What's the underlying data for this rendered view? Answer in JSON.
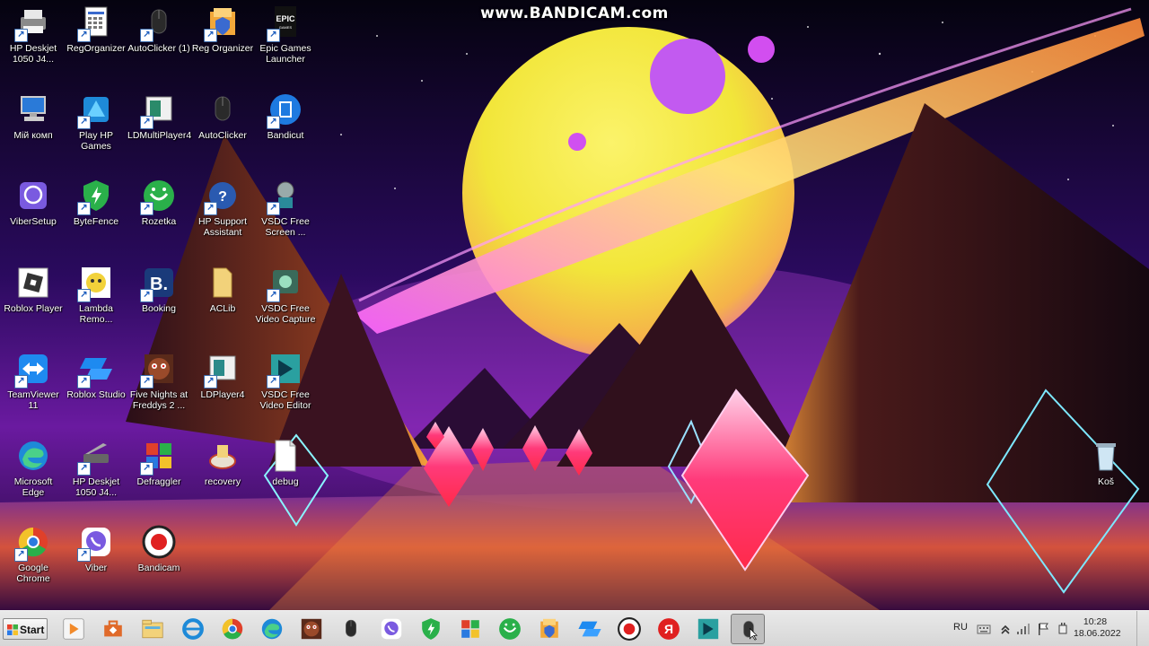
{
  "watermark": "www.BANDICAM.com",
  "desktop": {
    "icons": [
      {
        "label": "HP Deskjet 1050 J4...",
        "icon": "printer-icon"
      },
      {
        "label": "RegOrganizer",
        "icon": "registry-document-icon"
      },
      {
        "label": "AutoClicker (1)",
        "icon": "mouse-icon"
      },
      {
        "label": "Reg Organizer",
        "icon": "reg-organizer-icon"
      },
      {
        "label": "Epic Games Launcher",
        "icon": "epic-games-icon"
      },
      {
        "label": "Мій комп",
        "icon": "computer-icon"
      },
      {
        "label": "Play HP Games",
        "icon": "hp-games-icon"
      },
      {
        "label": "LDMultiPlayer4",
        "icon": "ldmultiplayer-icon"
      },
      {
        "label": "AutoClicker",
        "icon": "mouse-icon"
      },
      {
        "label": "Bandicut",
        "icon": "bandicut-icon"
      },
      {
        "label": "ViberSetup",
        "icon": "viber-setup-icon"
      },
      {
        "label": "ByteFence",
        "icon": "bytefence-shield-icon"
      },
      {
        "label": "Rozetka",
        "icon": "rozetka-icon"
      },
      {
        "label": "HP Support Assistant",
        "icon": "hp-support-icon"
      },
      {
        "label": "VSDC Free Screen ...",
        "icon": "vsdc-screen-icon"
      },
      {
        "label": "Roblox Player",
        "icon": "roblox-icon"
      },
      {
        "label": "Lambda Remo...",
        "icon": "lambda-remover-icon"
      },
      {
        "label": "Booking",
        "icon": "booking-icon"
      },
      {
        "label": "ACLib",
        "icon": "folder-icon"
      },
      {
        "label": "VSDC Free Video Capture",
        "icon": "vsdc-capture-icon"
      },
      {
        "label": "TeamViewer 11",
        "icon": "teamviewer-icon"
      },
      {
        "label": "Roblox Studio",
        "icon": "roblox-studio-icon"
      },
      {
        "label": "Five Nights at Freddys 2 ...",
        "icon": "fnaf-icon"
      },
      {
        "label": "LDPlayer4",
        "icon": "ldplayer-icon"
      },
      {
        "label": "VSDC Free Video Editor",
        "icon": "vsdc-editor-icon"
      },
      {
        "label": "Microsoft Edge",
        "icon": "edge-icon"
      },
      {
        "label": "HP Deskjet 1050 J4...",
        "icon": "scanner-icon"
      },
      {
        "label": "Defraggler",
        "icon": "defraggler-icon"
      },
      {
        "label": "recovery",
        "icon": "recovery-icon"
      },
      {
        "label": "debug",
        "icon": "text-file-icon"
      },
      {
        "label": "Google Chrome",
        "icon": "chrome-icon"
      },
      {
        "label": "Viber",
        "icon": "viber-icon"
      },
      {
        "label": "Bandicam",
        "icon": "bandicam-icon"
      },
      {
        "label": "Koš",
        "icon": "recycle-bin-icon"
      }
    ]
  },
  "taskbar": {
    "start_label": "Start",
    "buttons": [
      "media-player-icon",
      "toolbox-icon",
      "file-explorer-icon",
      "internet-explorer-icon",
      "chrome-icon",
      "edge-icon",
      "fnaf-icon",
      "mouse-icon",
      "viber-icon",
      "bytefence-shield-icon",
      "defraggler-icon",
      "rozetka-icon",
      "reg-organizer-icon",
      "roblox-studio-icon",
      "bandicam-icon",
      "yandex-icon",
      "vsdc-editor-icon",
      "autoclicker-active-icon"
    ],
    "tray": {
      "language": "RU",
      "time": "10:28",
      "date": "18.06.2022"
    }
  },
  "colors": {
    "planet": "#f2ea3a",
    "ring": "#d860ff",
    "taskbar": "#dcdcdc"
  }
}
